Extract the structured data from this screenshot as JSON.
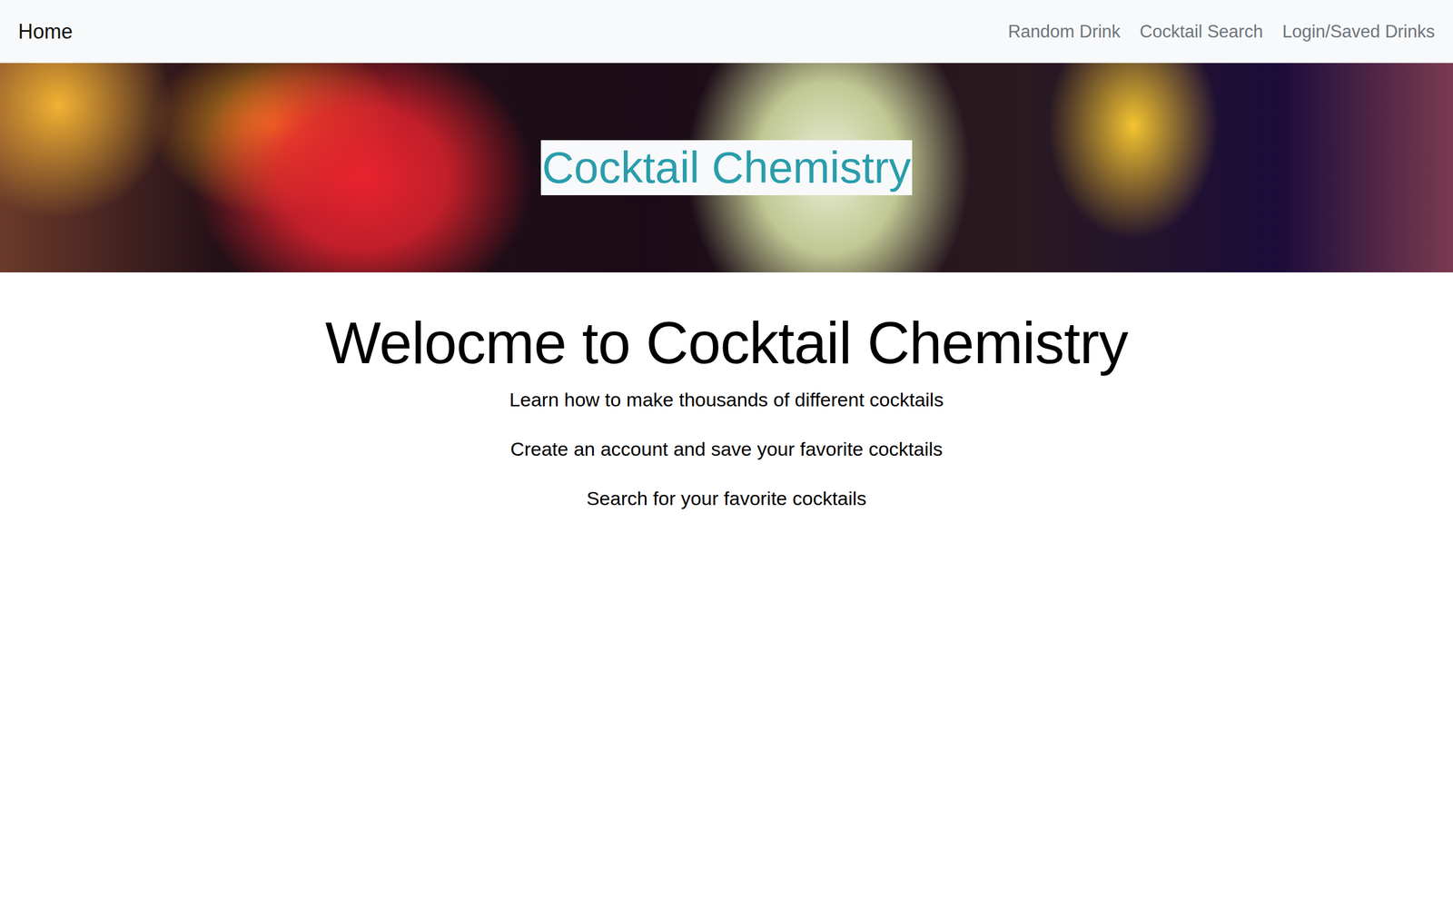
{
  "navbar": {
    "brand": "Home",
    "links": [
      "Random Drink",
      "Cocktail Search",
      "Login/Saved Drinks"
    ]
  },
  "hero": {
    "title": "Cocktail Chemistry"
  },
  "main": {
    "heading": "Welocme to Cocktail Chemistry",
    "paragraphs": [
      "Learn how to make thousands of different cocktails",
      "Create an account and save your favorite cocktails",
      "Search for your favorite cocktails"
    ]
  }
}
